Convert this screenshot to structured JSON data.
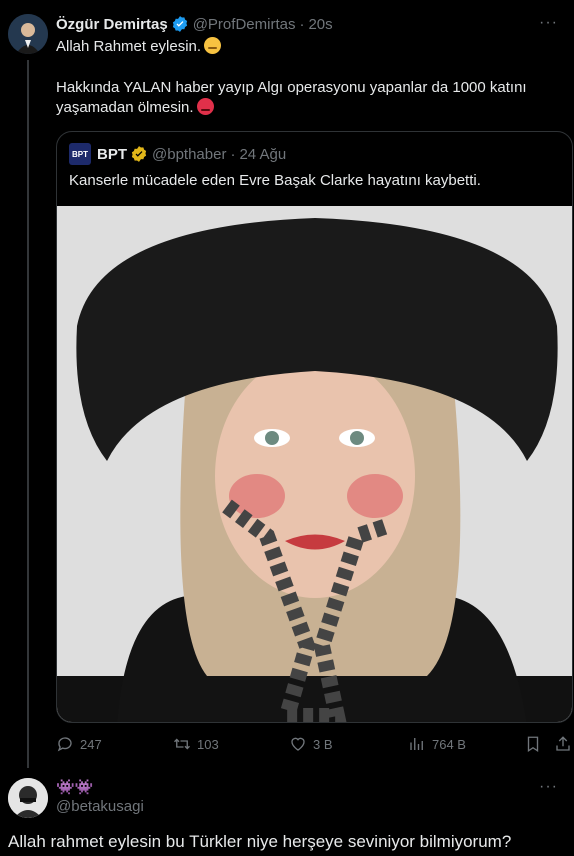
{
  "main_tweet": {
    "author_name": "Özgür Demirtaş",
    "handle": "@ProfDemirtas",
    "separator": "·",
    "time": "20s",
    "more_label": "···",
    "line1": "Allah Rahmet eylesin.",
    "line2": "Hakkında YALAN haber yayıp Algı operasyonu yapanlar da 1000 katını yaşamadan ölmesin."
  },
  "quoted_tweet": {
    "logo_text": "BPT",
    "author_name": "BPT",
    "handle": "@bpthaber",
    "separator": "·",
    "time": "24 Ağu",
    "text": "Kanserle mücadele eden Evre Başak Clarke hayatını kaybetti."
  },
  "actions": {
    "replies": "247",
    "retweets": "103",
    "likes": "3 B",
    "views": "764 B"
  },
  "reply": {
    "author_name": "👾👾",
    "handle": "@betakusagi",
    "more_label": "···",
    "text": "Allah rahmet eylesin bu Türkler niye herşeye seviniyor bilmiyorum?"
  },
  "icons": [
    "verified-badge-icon",
    "gold-verified-badge-icon",
    "reply-icon",
    "retweet-icon",
    "like-icon",
    "views-icon",
    "bookmark-icon",
    "share-icon",
    "more-icon"
  ],
  "colors": {
    "background": "#000000",
    "text": "#e7e9ea",
    "muted": "#71767b",
    "verified_blue": "#1d9bf0",
    "verified_gold": "#e2b719",
    "border": "#2f3336"
  }
}
